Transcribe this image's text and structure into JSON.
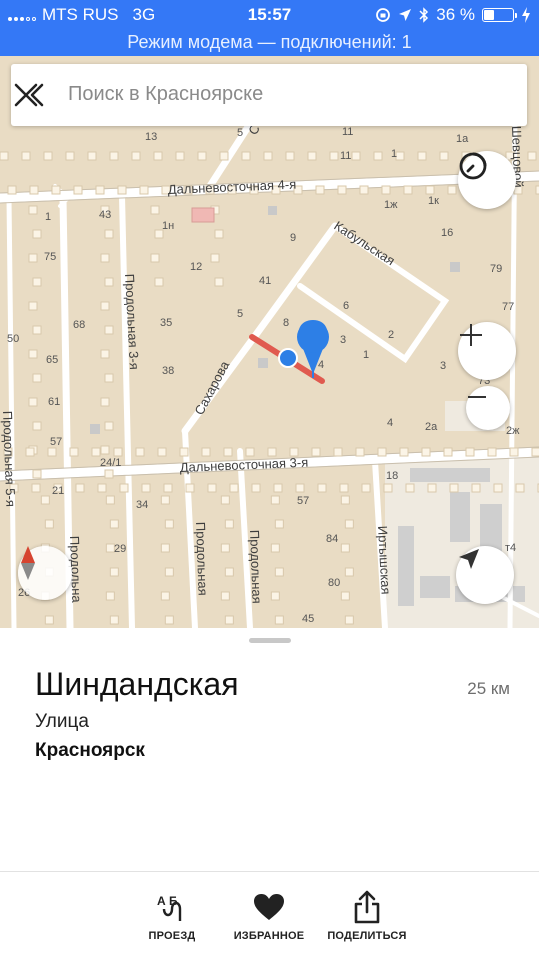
{
  "status_bar": {
    "carrier": "MTS RUS",
    "network": "3G",
    "time": "15:57",
    "battery": "36 %",
    "battery_level": 0.36
  },
  "hotspot_banner": "Режим модема — подключений: 1",
  "search": {
    "placeholder": "Поиск в Красноярске"
  },
  "map": {
    "streets": {
      "dalnevostochnaya_4": "Дальневосточная 4-я",
      "dalnevostochnaya_3": "Дальневосточная 3-я",
      "kabulskaya": "Кабульская",
      "sakharova": "Сахарова",
      "prodolnaya_3": "Продольная 3-я",
      "prodolnaya_5": "Продольная 5-я",
      "prodolnaya_a": "Продольна",
      "prodolnaya_b": "Продольная",
      "prodolnaya_c": "Продольная",
      "irtyshskaya": "Иртышская",
      "shevchenko": "Шевцовой",
      "top_street": "С"
    },
    "house_numbers": [
      {
        "id": "h13",
        "t": "13"
      },
      {
        "id": "h11a",
        "t": "11"
      },
      {
        "id": "h1a",
        "t": "1а"
      },
      {
        "id": "h11b",
        "t": "11"
      },
      {
        "id": "h1",
        "t": "1"
      },
      {
        "id": "h5a",
        "t": "5"
      },
      {
        "id": "h1zh",
        "t": "1ж"
      },
      {
        "id": "h1k",
        "t": "1к"
      },
      {
        "id": "h43",
        "t": "43"
      },
      {
        "id": "h1n",
        "t": "1н"
      },
      {
        "id": "h9",
        "t": "9"
      },
      {
        "id": "h16",
        "t": "16"
      },
      {
        "id": "h1b",
        "t": "1"
      },
      {
        "id": "h75",
        "t": "75"
      },
      {
        "id": "h12",
        "t": "12"
      },
      {
        "id": "h79",
        "t": "79"
      },
      {
        "id": "h41",
        "t": "41"
      },
      {
        "id": "h6",
        "t": "6"
      },
      {
        "id": "h77",
        "t": "77"
      },
      {
        "id": "h68",
        "t": "68"
      },
      {
        "id": "h35",
        "t": "35"
      },
      {
        "id": "h5b",
        "t": "5"
      },
      {
        "id": "h8",
        "t": "8"
      },
      {
        "id": "h2",
        "t": "2"
      },
      {
        "id": "h50",
        "t": "50"
      },
      {
        "id": "h3a",
        "t": "3"
      },
      {
        "id": "h1c",
        "t": "1"
      },
      {
        "id": "h65",
        "t": "65"
      },
      {
        "id": "h4a",
        "t": "4"
      },
      {
        "id": "h3b",
        "t": "3"
      },
      {
        "id": "h38",
        "t": "38"
      },
      {
        "id": "h61",
        "t": "61"
      },
      {
        "id": "h4b",
        "t": "4"
      },
      {
        "id": "h2a",
        "t": "2а"
      },
      {
        "id": "h2zh",
        "t": "2ж"
      },
      {
        "id": "h57a",
        "t": "57"
      },
      {
        "id": "h24",
        "t": "24/1"
      },
      {
        "id": "h18",
        "t": "18"
      },
      {
        "id": "h21",
        "t": "21"
      },
      {
        "id": "h34",
        "t": "34"
      },
      {
        "id": "h57b",
        "t": "57"
      },
      {
        "id": "h29",
        "t": "29"
      },
      {
        "id": "h84",
        "t": "84"
      },
      {
        "id": "h80",
        "t": "80"
      },
      {
        "id": "h45",
        "t": "45"
      },
      {
        "id": "h26",
        "t": "26"
      },
      {
        "id": "h73",
        "t": "73"
      },
      {
        "id": "ht4",
        "t": "т4"
      }
    ]
  },
  "place": {
    "name": "Шиндандская",
    "distance": "25 км",
    "type": "Улица",
    "city": "Красноярск"
  },
  "toolbar": {
    "route_label": "ПРОЕЗД",
    "route_icon_text": "А Б",
    "favorites_label": "ИЗБРАННОЕ",
    "share_label": "ПОДЕЛИТЬСЯ"
  },
  "colors": {
    "status_blue": "#3478f6",
    "map_bg": "#e9dcc4",
    "road": "#ffffff",
    "pin_blue": "#2d7fe6",
    "route_red": "#e05a4f"
  }
}
